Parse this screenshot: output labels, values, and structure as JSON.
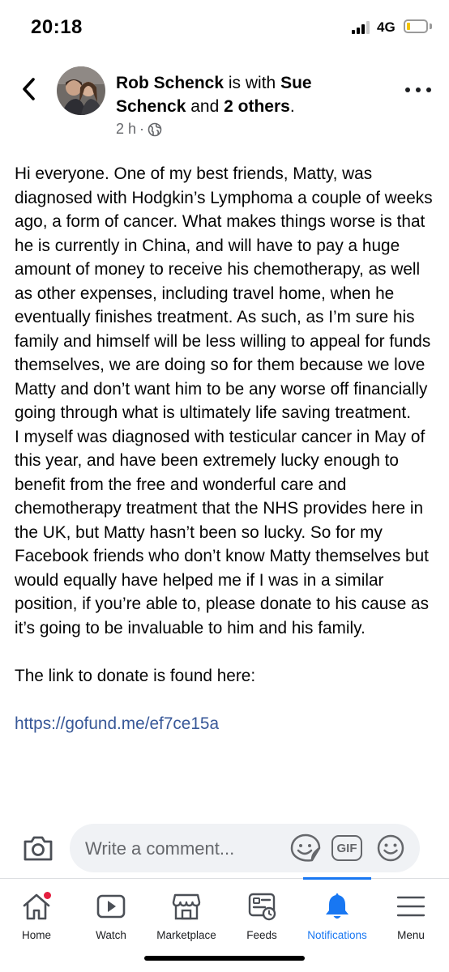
{
  "status_bar": {
    "time": "20:18",
    "network": "4G",
    "battery_color": "#f2c300"
  },
  "post": {
    "author": "Rob Schenck",
    "with_text": " is with ",
    "tagged": "Sue Schenck",
    "and_text": " and ",
    "others": "2 others",
    "period": ".",
    "time_ago": "2 h",
    "separator": "·",
    "audience_icon": "globe-icon",
    "paragraph_1": "Hi everyone. One of my best friends, Matty, was diagnosed with Hodgkin’s Lymphoma a couple of weeks ago, a form of cancer. What makes things worse is that he is currently in China, and will have to pay a huge amount of money to receive his chemotherapy, as well as other expenses, including travel home, when he eventually finishes treatment. As such, as I’m sure his family and himself will be less willing to appeal for funds themselves, we are doing so for them because we love Matty and don’t want him to be any worse off financially going through what is ultimately life saving treatment.",
    "paragraph_2": "I myself was diagnosed with testicular cancer in May of this year, and have been extremely lucky enough to benefit from the free and wonderful care and chemotherapy treatment that the NHS provides here in the UK, but Matty hasn’t been so lucky. So for my Facebook friends who don’t know Matty themselves but would equally have helped me if I was in a similar position, if you’re able to, please donate to his cause as it’s going to be invaluable to him and his family.",
    "paragraph_3": "The link to donate is found here:",
    "link": "https://gofund.me/ef7ce15a"
  },
  "comment_bar": {
    "placeholder": "Write a comment...",
    "gif_label": "GIF"
  },
  "tabs": [
    {
      "label": "Home",
      "icon": "home-icon",
      "badge": true
    },
    {
      "label": "Watch",
      "icon": "watch-icon"
    },
    {
      "label": "Marketplace",
      "icon": "marketplace-icon"
    },
    {
      "label": "Feeds",
      "icon": "feeds-icon"
    },
    {
      "label": "Notifications",
      "icon": "bell-icon",
      "active": true
    },
    {
      "label": "Menu",
      "icon": "menu-icon"
    }
  ],
  "colors": {
    "accent": "#1877f2",
    "link": "#385898",
    "badge": "#e41e3f",
    "secondary_text": "#65676b"
  }
}
